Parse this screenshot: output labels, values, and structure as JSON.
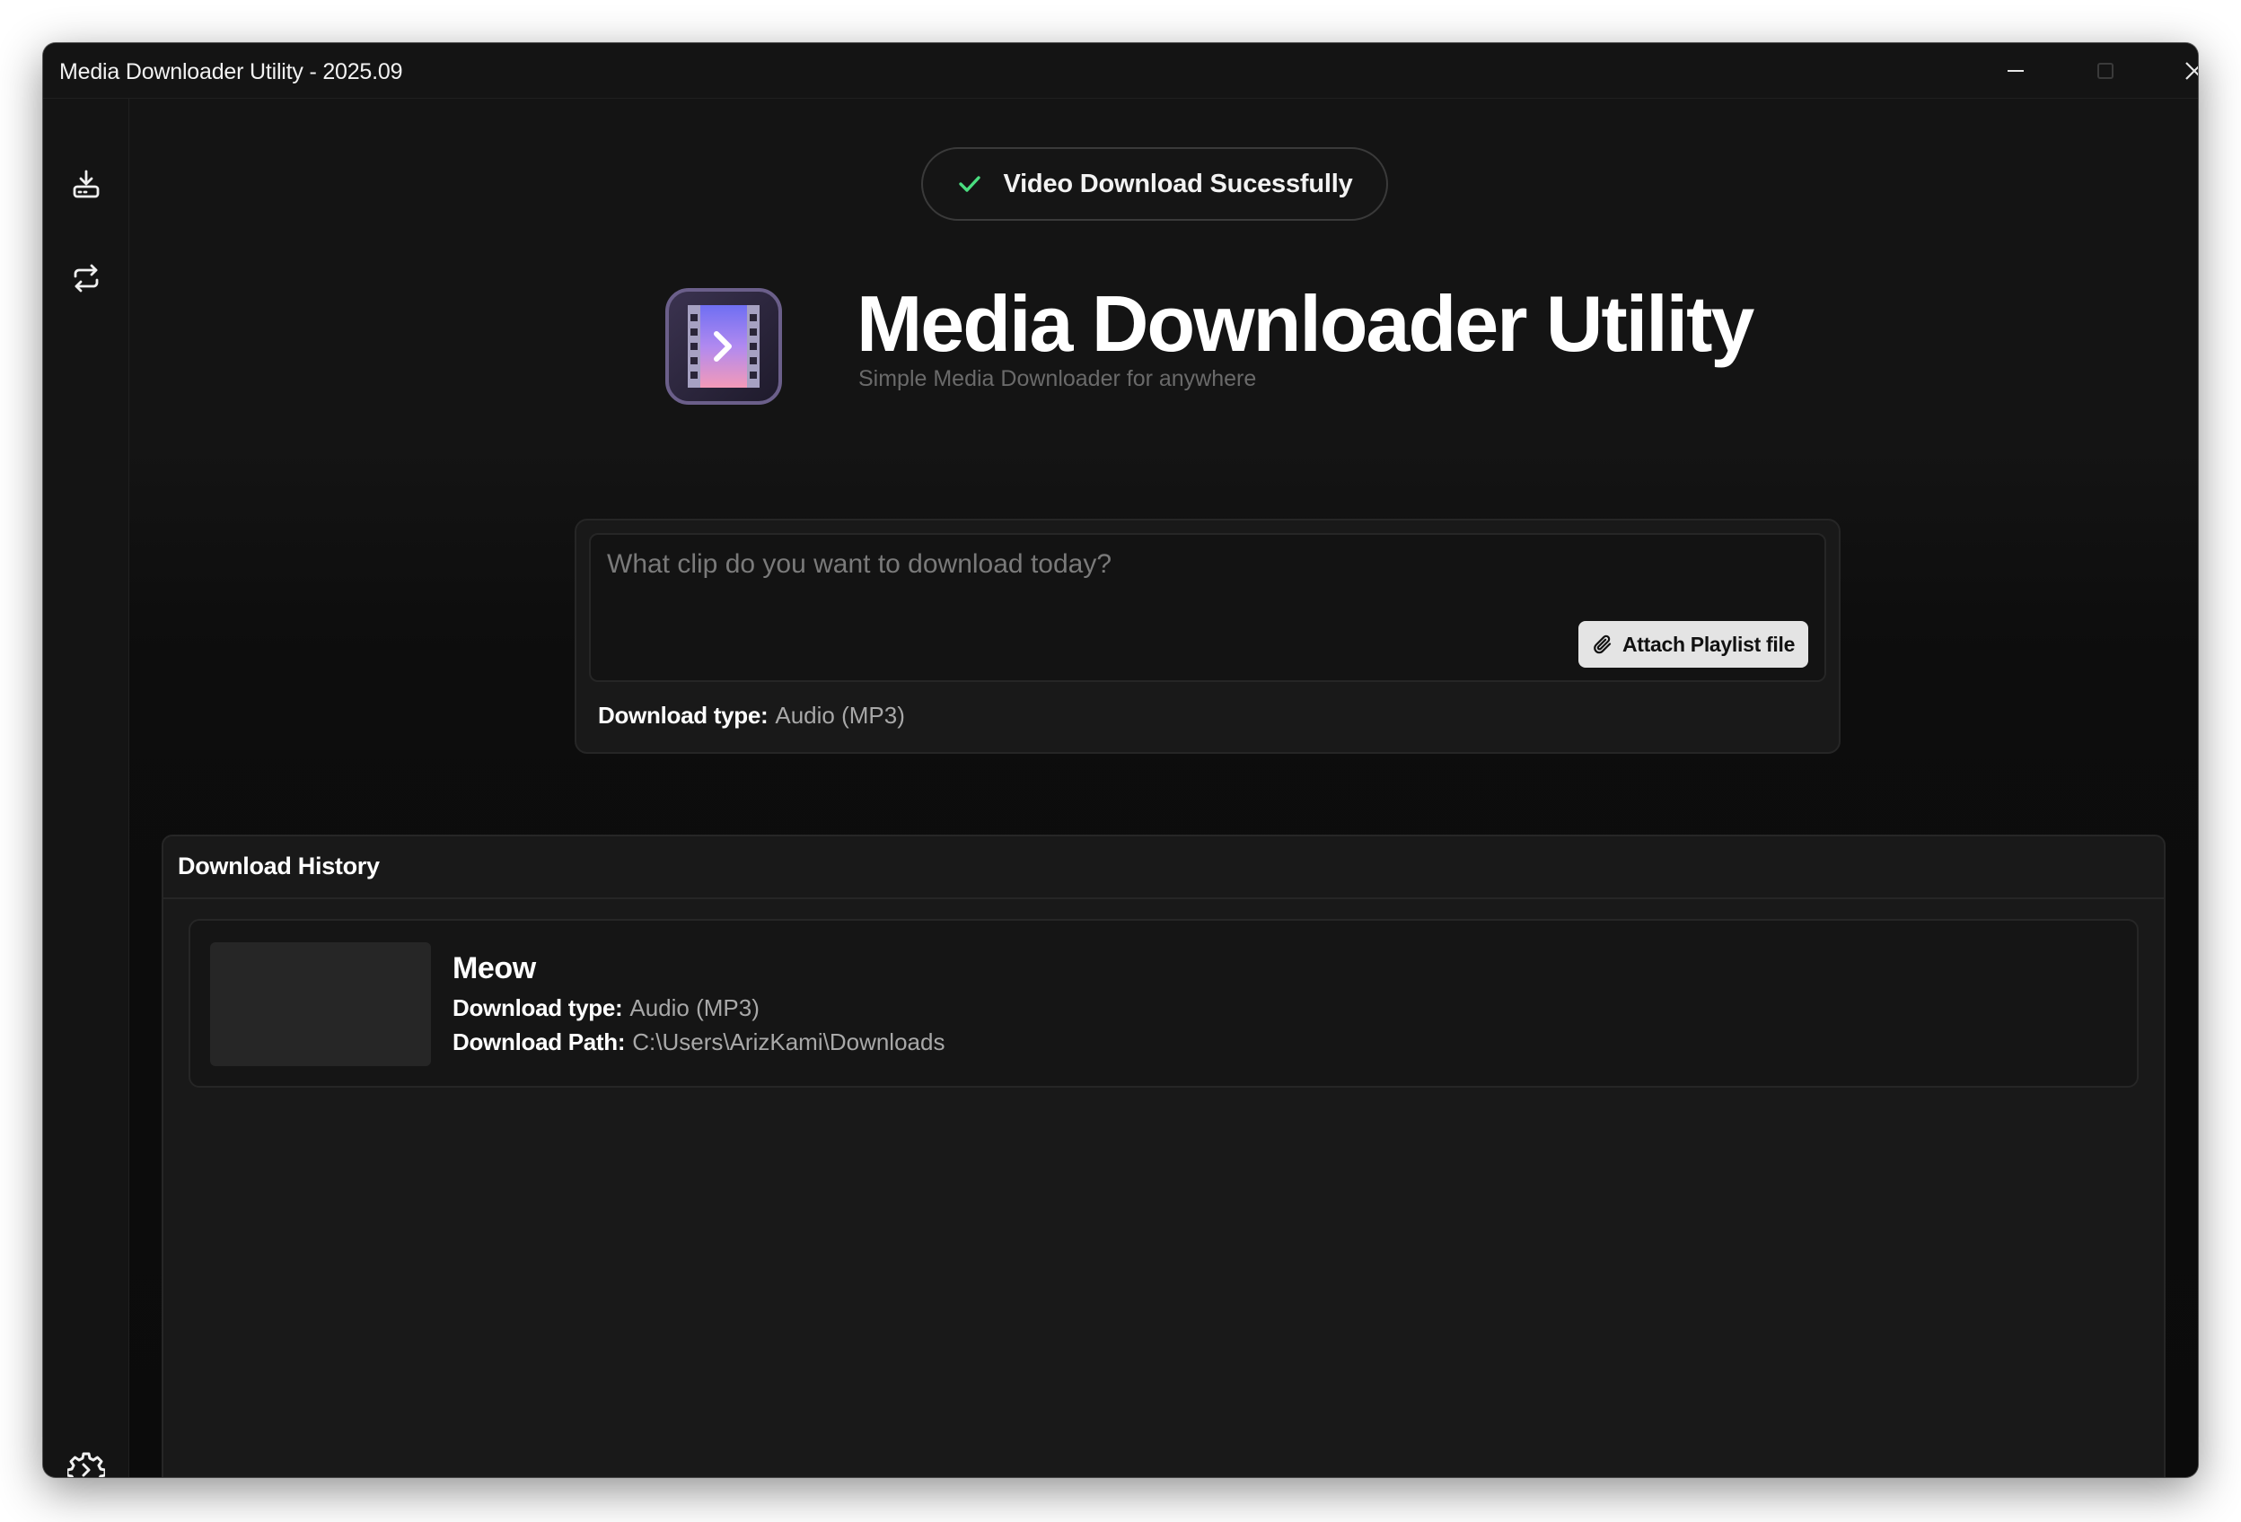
{
  "window": {
    "title": "Media Downloader Utility - 2025.09"
  },
  "sidebar": {
    "items": [
      {
        "name": "download",
        "icon": "download-icon"
      },
      {
        "name": "convert",
        "icon": "convert-arrows-icon"
      }
    ],
    "settings_icon": "gear-icon"
  },
  "toast": {
    "icon": "check-icon",
    "text": "Video Download Sucessfully",
    "accent": "#4ade80"
  },
  "header": {
    "title": "Media Downloader Utility",
    "subtitle": "Simple Media Downloader for anywhere"
  },
  "input": {
    "placeholder": "What clip do you want to download today?",
    "attach_label": "Attach Playlist file",
    "download_type_label": "Download type:",
    "download_type_value": "Audio (MP3)"
  },
  "history": {
    "title": "Download History",
    "items": [
      {
        "title": "Meow",
        "type_label": "Download type:",
        "type_value": "Audio (MP3)",
        "path_label": "Download Path:",
        "path_value": "C:\\Users\\ArizKami\\Downloads"
      }
    ]
  }
}
